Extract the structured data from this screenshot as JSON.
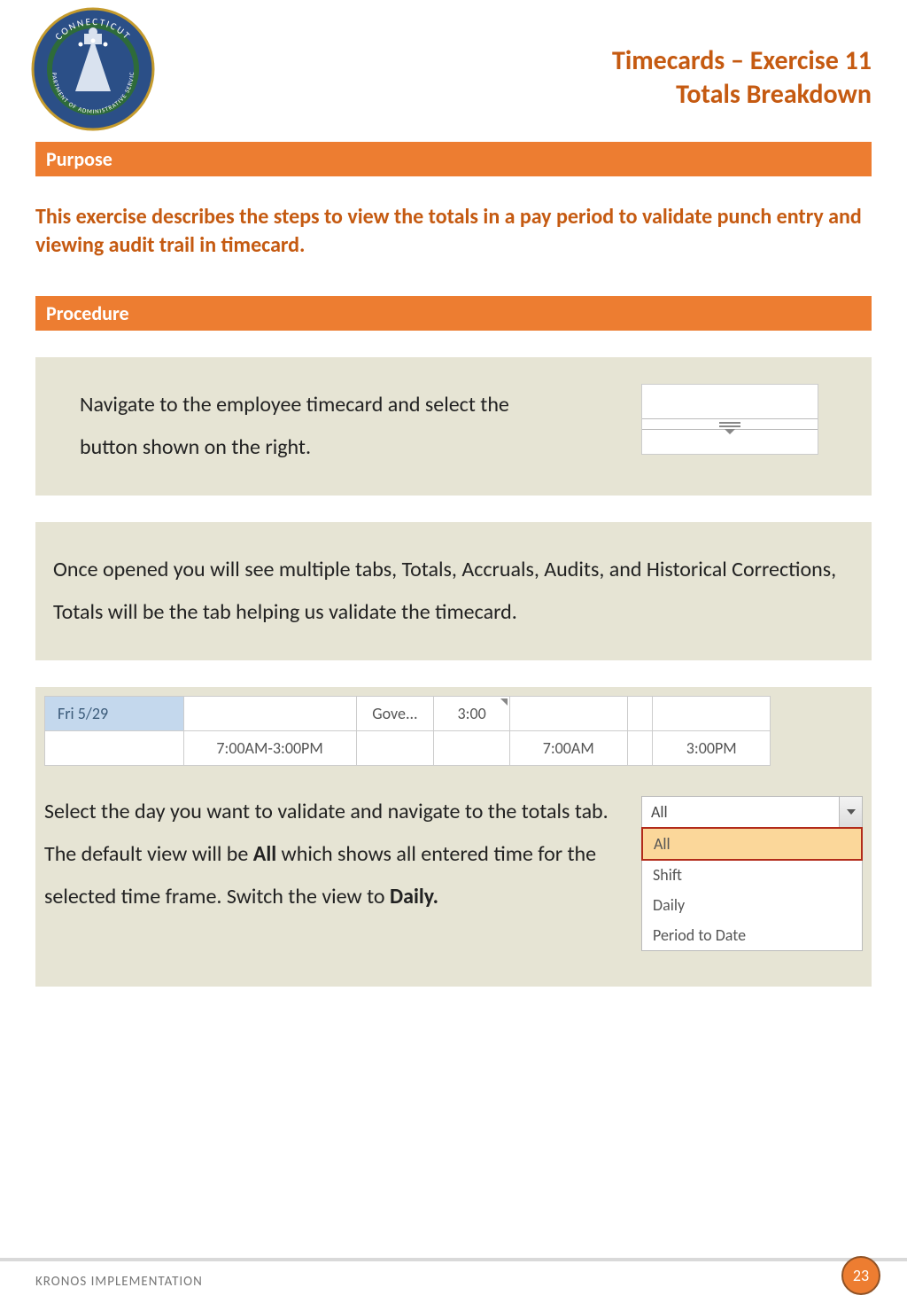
{
  "header": {
    "title_line1": "Timecards – Exercise 11",
    "title_line2": "Totals Breakdown"
  },
  "sections": {
    "purpose_label": "Purpose",
    "purpose_text": "This exercise describes the steps to view the totals in a pay period to validate punch entry and viewing audit trail in timecard.",
    "procedure_label": "Procedure"
  },
  "steps": {
    "step1": "Navigate to the employee timecard and select the button shown on the right.",
    "step2": "Once opened you will see multiple tabs, Totals, Accruals, Audits, and Historical Corrections, Totals will be the tab helping us validate the timecard.",
    "step3_part1": "Select the day you want to validate and navigate to the totals tab. The default view will be ",
    "step3_bold1": "All",
    "step3_part2": " which shows all entered time for the selected time frame. Switch the view to ",
    "step3_bold2": "Daily."
  },
  "timecard_rows": {
    "r0": {
      "date": "Fri 5/29",
      "sched": "",
      "gove": "Gove...",
      "time": "3:00",
      "in": "",
      "out": ""
    },
    "r1": {
      "date": "",
      "sched": "7:00AM-3:00PM",
      "gove": "",
      "time": "",
      "in": "7:00AM",
      "out": "3:00PM"
    }
  },
  "dropdown": {
    "selected": "All",
    "items": {
      "i0": "All",
      "i1": "Shift",
      "i2": "Daily",
      "i3": "Period to Date"
    }
  },
  "footer": {
    "text": "KRONOS IMPLEMENTATION",
    "page": "23"
  },
  "colors": {
    "accent": "#ED7D31",
    "title": "#C55A11",
    "block_bg": "#E6E4D4"
  }
}
